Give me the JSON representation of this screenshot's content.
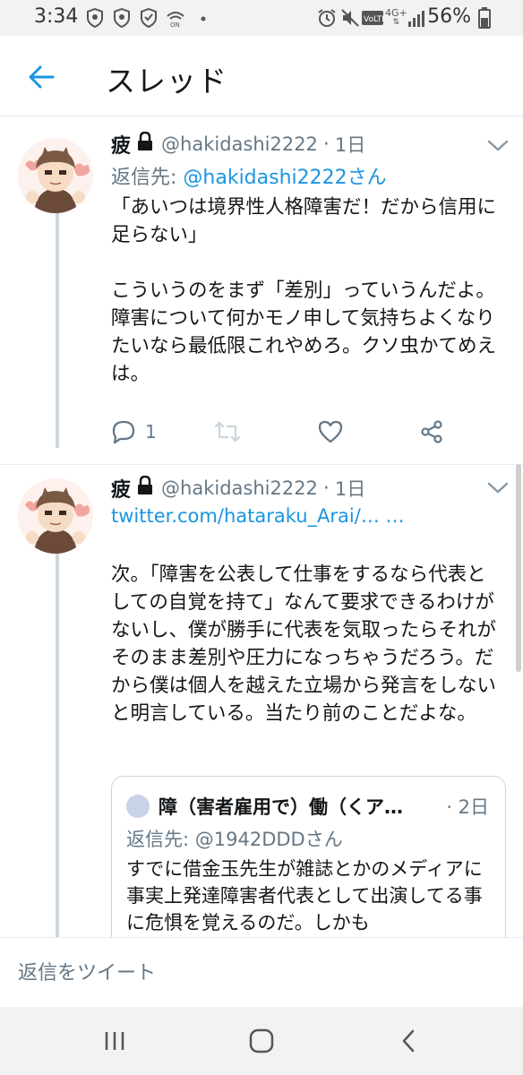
{
  "status_bar": {
    "time": "3:34",
    "battery_percent": "56%",
    "network": "4G+",
    "volte": "VoLTE",
    "icons": [
      "shield-icon",
      "shield-icon",
      "shield-icon",
      "wifi-calling-icon",
      "more-icon",
      "alarm-icon",
      "mute-icon",
      "volte-icon",
      "signal-icon",
      "battery-icon"
    ]
  },
  "header": {
    "title": "スレッド",
    "back_icon": "back-arrow-icon"
  },
  "tweets": [
    {
      "name": "疲",
      "handle": "@hakidashi2222",
      "separator": "·",
      "time": "1日",
      "reply_prefix": "返信先: ",
      "reply_to": "@hakidashi2222さん",
      "body": "「あいつは境界性人格障害だ！だから信用に足らない」\n\nこういうのをまず「差別」っていうんだよ。障害について何かモノ申して気持ちよくなりたいなら最低限これやめろ。クソ虫かてめえは。",
      "reply_count": "1"
    },
    {
      "name": "疲",
      "handle": "@hakidashi2222",
      "separator": "·",
      "time": "1日",
      "link": "twitter.com/hataraku_Arai/… …",
      "body": "次。「障害を公表して仕事をするなら代表としての自覚を持て」なんて要求できるわけがないし、僕が勝手に代表を気取ったらそれがそのまま差別や圧力になっちゃうだろう。だから僕は個人を越えた立場から発言をしないと明言している。当たり前のことだよな。"
    }
  ],
  "quote": {
    "name": "障（害者雇用で）働（くア…",
    "time": "· 2日",
    "reply": "返信先: @1942DDDさん",
    "body": "すでに借金玉先生が雑誌とかのメディアに事実上発達障害者代表として出演してる事に危惧を覚えるのだ。しかも"
  },
  "composer": {
    "placeholder": "返信をツイート"
  },
  "colors": {
    "accent": "#1b95e0",
    "secondary_text": "#657786",
    "text": "#14171a",
    "thread_line": "#ccd6dd"
  }
}
